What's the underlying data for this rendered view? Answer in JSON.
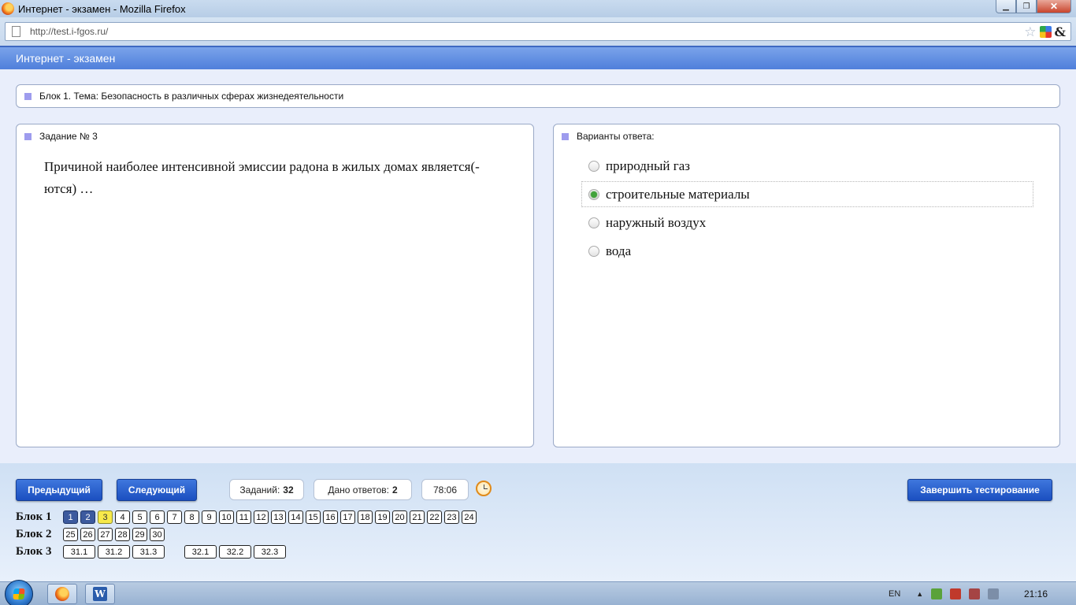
{
  "window": {
    "title": "Интернет - экзамен - Mozilla Firefox",
    "url": "http://test.i-fgos.ru/"
  },
  "app": {
    "header": "Интернет - экзамен",
    "block_title": "Блок 1. Тема: Безопасность в различных сферах жизнедеятельности"
  },
  "task": {
    "label": "Задание № 3",
    "question": "Причиной наиболее интенсивной эмиссии радона в жилых домах является(-ются) …"
  },
  "answers": {
    "label": "Варианты ответа:",
    "options": [
      {
        "text": "природный газ",
        "selected": false
      },
      {
        "text": "строительные материалы",
        "selected": true
      },
      {
        "text": "наружный воздух",
        "selected": false
      },
      {
        "text": "вода",
        "selected": false
      }
    ]
  },
  "controls": {
    "prev": "Предыдущий",
    "next": "Следующий",
    "tasks_label": "Заданий:",
    "tasks_count": "32",
    "answered_label": "Дано ответов:",
    "answered_count": "2",
    "timer": "78:06",
    "finish": "Завершить тестирование"
  },
  "navigation": {
    "block1_label": "Блок 1",
    "block1": [
      {
        "n": "1",
        "state": "answered"
      },
      {
        "n": "2",
        "state": "answered"
      },
      {
        "n": "3",
        "state": "current"
      },
      {
        "n": "4",
        "state": "none"
      },
      {
        "n": "5",
        "state": "none"
      },
      {
        "n": "6",
        "state": "none"
      },
      {
        "n": "7",
        "state": "none"
      },
      {
        "n": "8",
        "state": "none"
      },
      {
        "n": "9",
        "state": "none"
      },
      {
        "n": "10",
        "state": "none"
      },
      {
        "n": "11",
        "state": "none"
      },
      {
        "n": "12",
        "state": "none"
      },
      {
        "n": "13",
        "state": "none"
      },
      {
        "n": "14",
        "state": "none"
      },
      {
        "n": "15",
        "state": "none"
      },
      {
        "n": "16",
        "state": "none"
      },
      {
        "n": "17",
        "state": "none"
      },
      {
        "n": "18",
        "state": "none"
      },
      {
        "n": "19",
        "state": "none"
      },
      {
        "n": "20",
        "state": "none"
      },
      {
        "n": "21",
        "state": "none"
      },
      {
        "n": "22",
        "state": "none"
      },
      {
        "n": "23",
        "state": "none"
      },
      {
        "n": "24",
        "state": "none"
      }
    ],
    "block2_label": "Блок 2",
    "block2": [
      "25",
      "26",
      "27",
      "28",
      "29",
      "30"
    ],
    "block3_label": "Блок 3",
    "block3_a": [
      "31.1",
      "31.2",
      "31.3"
    ],
    "block3_b": [
      "32.1",
      "32.2",
      "32.3"
    ]
  },
  "taskbar": {
    "lang": "EN",
    "time": "21:16"
  }
}
